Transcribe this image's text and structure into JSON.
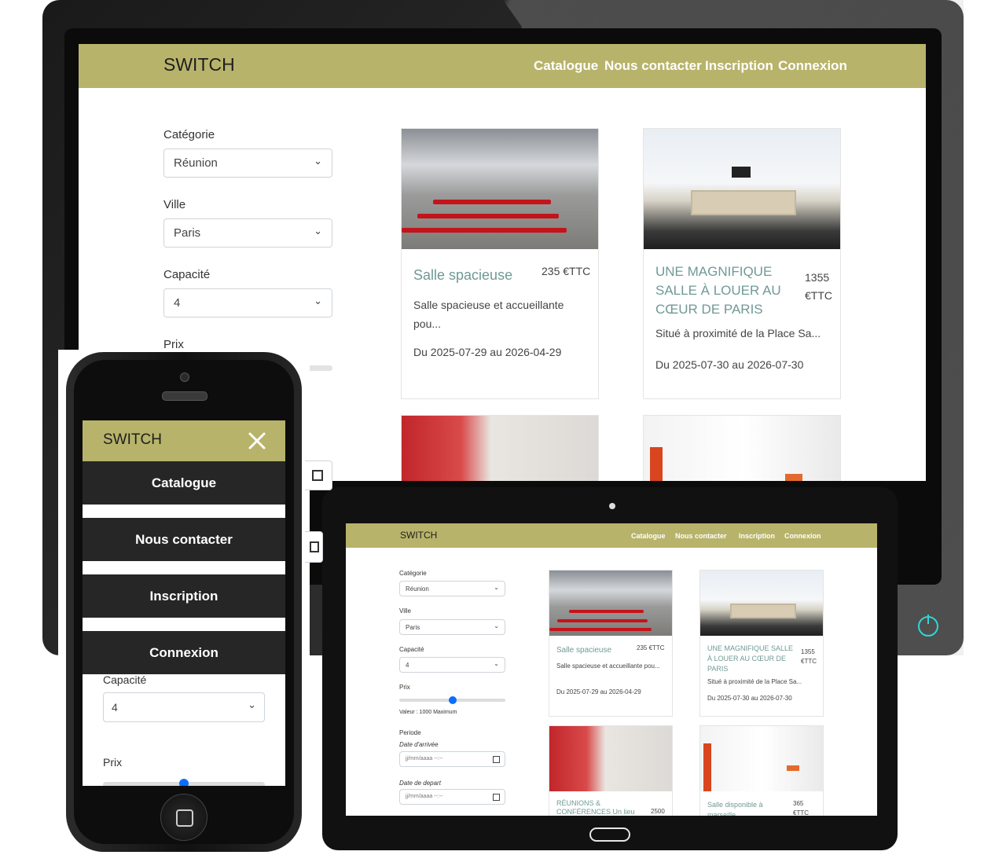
{
  "brand": "SWITCH",
  "nav": [
    "Catalogue",
    "Nous contacter",
    "Inscription",
    "Connexion"
  ],
  "filters": {
    "categorie_label": "Catégorie",
    "categorie_value": "Réunion",
    "ville_label": "Ville",
    "ville_value": "Paris",
    "capacite_label": "Capacité",
    "capacite_value": "4",
    "prix_label": "Prix",
    "prix_value_text": "Valeur : 1000 Maximum",
    "prix_fraction": 0.5,
    "periode_label": "Periode",
    "arrivee_label": "Date d'arrivée",
    "depart_label": "Date de depart",
    "date_placeholder": "jj/mm/aaaa --:--"
  },
  "products": [
    {
      "title": "Salle spacieuse",
      "price": "235 €TTC",
      "desc": "Salle spacieuse et accueillante pou...",
      "dates": "Du 2025-07-29 au 2026-04-29"
    },
    {
      "title": "UNE MAGNIFIQUE SALLE À LOUER AU CŒUR DE PARIS",
      "price_line1": "1355",
      "price_line2": "€TTC",
      "desc": "Situé à proximité de la Place Sa...",
      "dates": "Du 2025-07-30 au 2026-07-30"
    },
    {
      "title": "RÉUNIONS & CONFÉRENCES Un lieu",
      "price": "2500"
    },
    {
      "title": "Salle disponible à marseille",
      "price_line1": "365",
      "price_line2": "€TTC"
    }
  ],
  "phone": {
    "close_icon": "close-icon",
    "menu": [
      "Catalogue",
      "Nous contacter",
      "Inscription",
      "Connexion"
    ],
    "capacite_label": "Capacité",
    "capacite_value": "4",
    "prix_label": "Prix"
  },
  "colors": {
    "header": "#b8b36a",
    "title_teal": "#6f9a95",
    "menu_dark": "#262626",
    "power": "#2fd7d3"
  }
}
